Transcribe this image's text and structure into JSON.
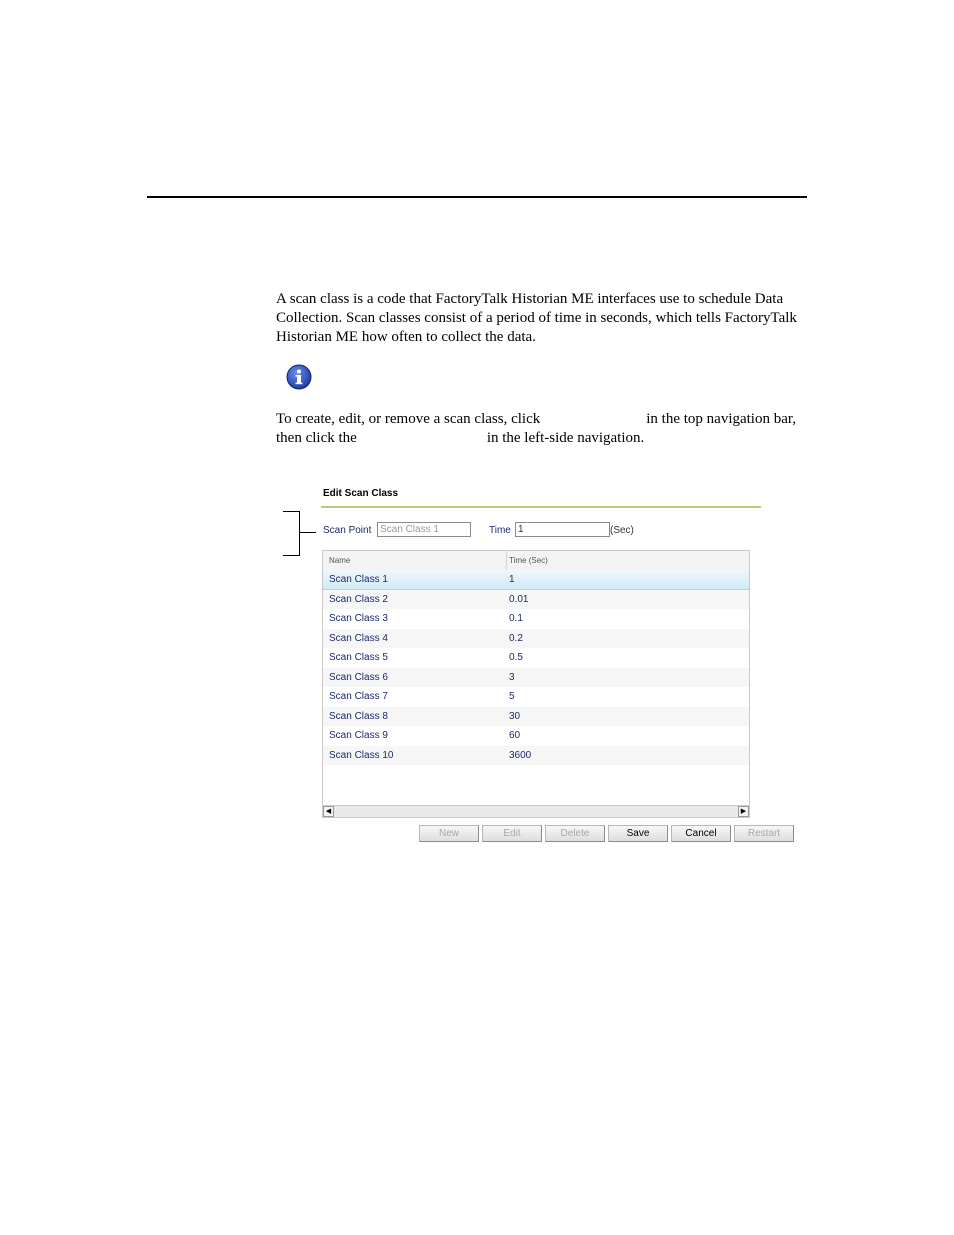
{
  "doc": {
    "para1": "A scan class is a code that FactoryTalk Historian ME interfaces use to schedule Data Collection. Scan classes consist of a period of time in seconds, which tells FactoryTalk Historian ME how often to collect the data.",
    "para2_a": "To create, edit, or remove a scan class, click",
    "para2_b": "in the top navigation bar, then click the",
    "para2_c": "in the left-side navigation."
  },
  "form": {
    "title": "Edit Scan Class",
    "scan_point_label": "Scan Point",
    "scan_point_value": "Scan Class 1",
    "time_label": "Time",
    "time_value": "1",
    "time_unit": "(Sec)"
  },
  "table": {
    "columns": [
      "Name",
      "Time (Sec)"
    ],
    "rows": [
      {
        "name": "Scan Class 1",
        "time": "1"
      },
      {
        "name": "Scan Class 2",
        "time": "0.01"
      },
      {
        "name": "Scan Class 3",
        "time": "0.1"
      },
      {
        "name": "Scan Class 4",
        "time": "0.2"
      },
      {
        "name": "Scan Class 5",
        "time": "0.5"
      },
      {
        "name": "Scan Class 6",
        "time": "3"
      },
      {
        "name": "Scan Class 7",
        "time": "5"
      },
      {
        "name": "Scan Class 8",
        "time": "30"
      },
      {
        "name": "Scan Class 9",
        "time": "60"
      },
      {
        "name": "Scan Class 10",
        "time": "3600"
      }
    ],
    "selected_index": 0
  },
  "buttons": [
    {
      "label": "New",
      "enabled": false
    },
    {
      "label": "Edit",
      "enabled": false
    },
    {
      "label": "Delete",
      "enabled": false
    },
    {
      "label": "Save",
      "enabled": true
    },
    {
      "label": "Cancel",
      "enabled": true
    },
    {
      "label": "Restart",
      "enabled": false
    }
  ],
  "colors": {
    "accent_rule": "#b6cc72",
    "info_icon": "#1f3fa6",
    "row_selected": "#cfeaf6"
  }
}
